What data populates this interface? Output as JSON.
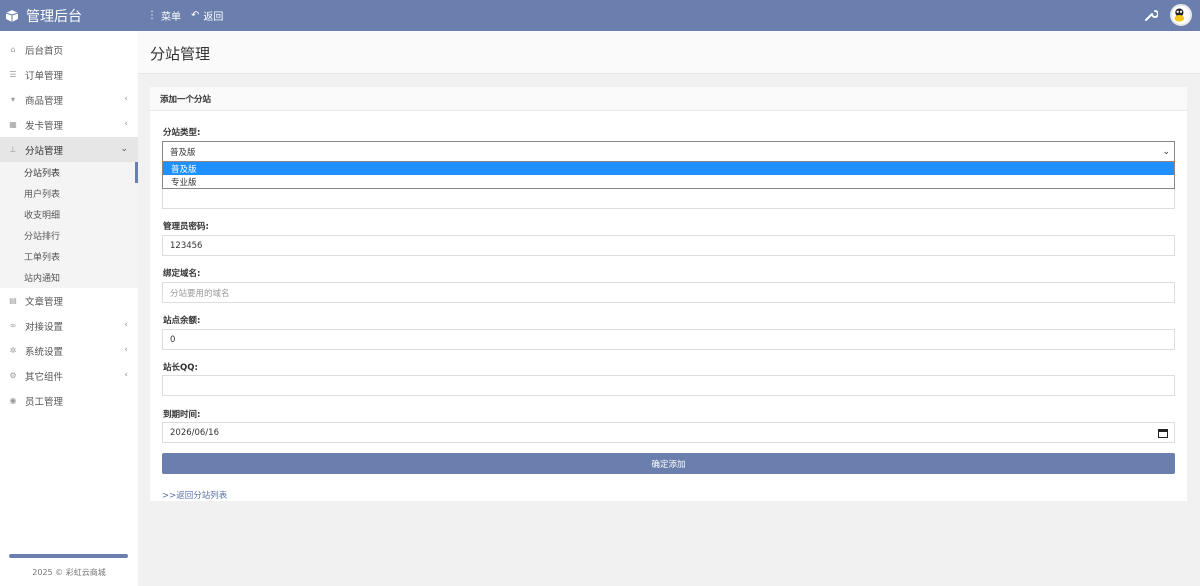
{
  "topbar": {
    "brand": "管理后台",
    "brand_icon": "cube-icon",
    "nav": [
      {
        "label": "菜单",
        "icon": "vertical-dots-icon"
      },
      {
        "label": "返回",
        "icon": "undo-icon"
      }
    ],
    "tools_icon": "wrench-icon",
    "avatar_icon": "avatar-icon"
  },
  "sidebar": {
    "items": [
      {
        "label": "后台首页",
        "icon": "home-icon",
        "chevron": ""
      },
      {
        "label": "订单管理",
        "icon": "list-icon",
        "chevron": ""
      },
      {
        "label": "商品管理",
        "icon": "cart-icon",
        "chevron": "‹"
      },
      {
        "label": "发卡管理",
        "icon": "grid-icon",
        "chevron": "‹"
      },
      {
        "label": "分站管理",
        "icon": "sitemap-icon",
        "chevron": "⌄"
      }
    ],
    "sub_items": [
      {
        "label": "分站列表"
      },
      {
        "label": "用户列表"
      },
      {
        "label": "收支明细"
      },
      {
        "label": "分站排行"
      },
      {
        "label": "工单列表"
      },
      {
        "label": "站内通知"
      }
    ],
    "items_after": [
      {
        "label": "文章管理",
        "icon": "article-icon",
        "chevron": ""
      },
      {
        "label": "对接设置",
        "icon": "connect-icon",
        "chevron": "‹"
      },
      {
        "label": "系统设置",
        "icon": "gear-icon",
        "chevron": "‹"
      },
      {
        "label": "其它组件",
        "icon": "cogs-icon",
        "chevron": "‹"
      },
      {
        "label": "员工管理",
        "icon": "user-circle-icon",
        "chevron": ""
      }
    ],
    "copyright": "2025 © 彩虹云商城"
  },
  "header": {
    "title": "分站管理"
  },
  "panel": {
    "title": "添加一个分站",
    "type_label": "分站类型:",
    "type_value": "普及版",
    "type_options": [
      "普及版",
      "专业版"
    ],
    "password_label": "管理员密码:",
    "password_value": "123456",
    "domain_label": "绑定域名:",
    "domain_placeholder": "分站要用的域名",
    "balance_label": "站点余额:",
    "balance_value": "0",
    "qq_label": "站长QQ:",
    "qq_value": "",
    "expiry_label": "到期时间:",
    "expiry_value": "2026/06/16",
    "submit_label": "确定添加",
    "back_link": ">>返回分站列表"
  },
  "colors": {
    "accent": "#6a7fae",
    "option_highlight": "#1e90ff"
  }
}
